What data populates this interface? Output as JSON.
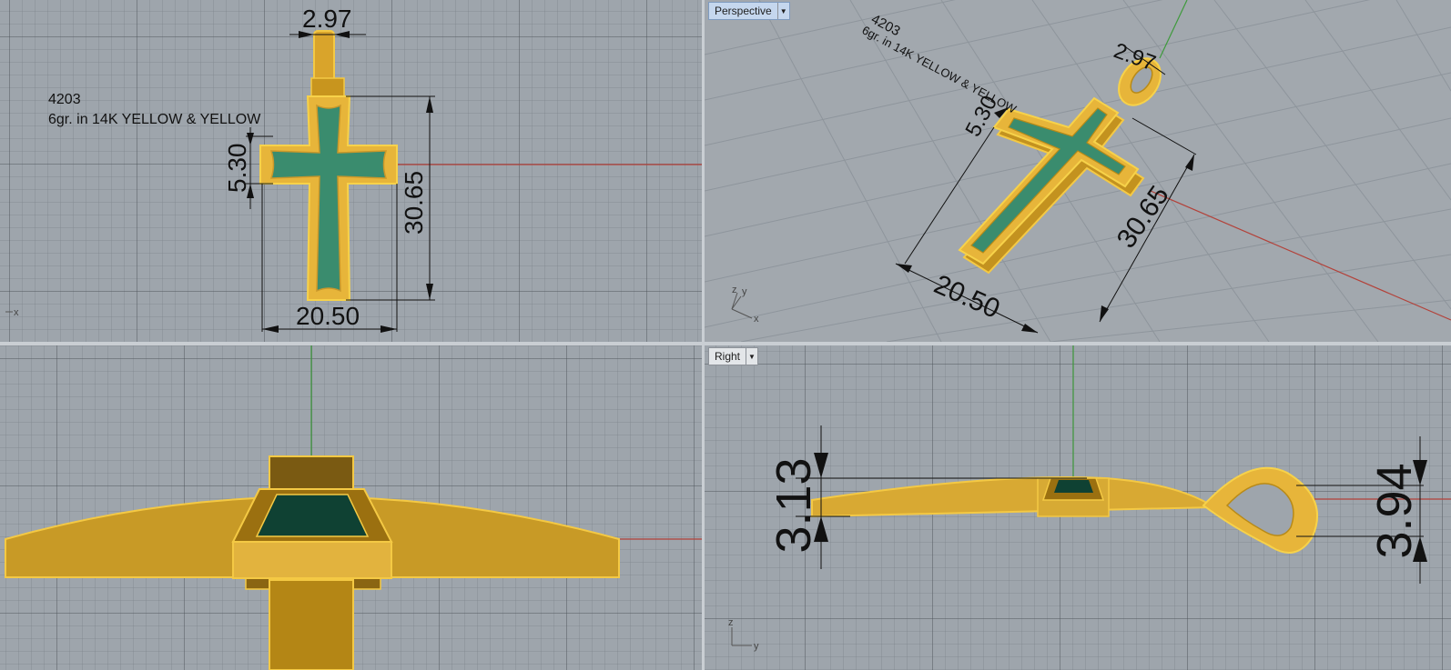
{
  "viewports": {
    "top": {
      "note_line1": "4203",
      "note_line2": "6gr. in 14K YELLOW & YELLOW",
      "dims": {
        "bail_width": "2.97",
        "arm_height": "5.30",
        "height": "30.65",
        "width": "20.50"
      },
      "axis_x": "x"
    },
    "perspective": {
      "label": "Perspective",
      "note_line1": "4203",
      "note_line2": "6gr. in 14K YELLOW & YELLOW",
      "dims": {
        "bail_width": "2.97",
        "arm_height": "5.30",
        "height": "30.65",
        "width": "20.50"
      },
      "axis_x": "x",
      "axis_y": "y",
      "axis_z": "z"
    },
    "front": {},
    "right": {
      "label": "Right",
      "dims": {
        "thickness": "3.13",
        "bail_depth": "3.94"
      },
      "axis_y": "y",
      "axis_z": "z"
    }
  },
  "colors": {
    "gold": "#e7b53a",
    "gold_dark": "#a5790e",
    "enamel": "#3a8c6e",
    "enamel_dark": "#0d3b2f",
    "x_axis": "#b3423a",
    "y_axis": "#3f9a3c"
  }
}
